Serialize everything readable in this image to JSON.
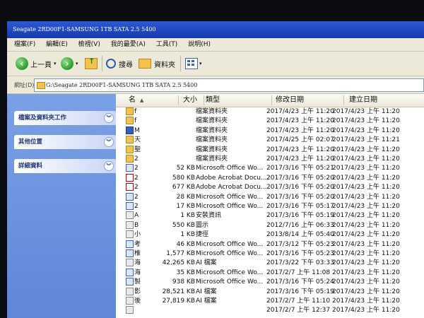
{
  "window": {
    "title": "Seagate 2RD00F1-SAMSUNG 1TB SATA 2.5 5400"
  },
  "menu": [
    "檔案(F)",
    "編輯(E)",
    "檢視(V)",
    "我的最愛(A)",
    "工具(T)",
    "說明(H)"
  ],
  "toolbar": {
    "back_label": "上一頁",
    "search_label": "搜尋",
    "folders_label": "資料夾"
  },
  "address": {
    "label": "網址(D)",
    "path": "G:\\Seagate 2RD00F1-SAMSUNG 1TB SATA 2.5 5400"
  },
  "task_panels": [
    "檔案及資料夾工作",
    "其他位置",
    "詳細資料"
  ],
  "columns": {
    "name": "名",
    "size": "大小",
    "type": "類型",
    "modified": "修改日期",
    "created": "建立日期"
  },
  "rows": [
    {
      "name": "f",
      "size": "",
      "type": "檔案資料夾",
      "modified": "2017/4/23 上午 11:20",
      "created": "2017/4/23 上午 11:20",
      "icon": "folder"
    },
    {
      "name": "f",
      "size": "",
      "type": "檔案資料夾",
      "modified": "2017/4/23 上午 11:20",
      "created": "2017/4/23 上午 11:20",
      "icon": "folder"
    },
    {
      "name": "M",
      "size": "",
      "type": "檔案資料夾",
      "modified": "2017/4/23 上午 11:20",
      "created": "2017/4/23 上午 11:20",
      "icon": "sel"
    },
    {
      "name": "天",
      "size": "",
      "type": "檔案資料夾",
      "modified": "2017/4/25 上午 02:07",
      "created": "2017/4/23 上午 11:21",
      "icon": "folder"
    },
    {
      "name": "聖",
      "size": "",
      "type": "檔案資料夾",
      "modified": "2017/4/23 上午 11:20",
      "created": "2017/4/23 上午 11:20",
      "icon": "folder"
    },
    {
      "name": "2",
      "size": "",
      "type": "檔案資料夾",
      "modified": "2017/4/23 上午 11:20",
      "created": "2017/4/23 上午 11:20",
      "icon": "folder"
    },
    {
      "name": "2",
      "size": "52 KB",
      "type": "Microsoft Office Wo...",
      "modified": "2017/3/16 下午 05:21",
      "created": "2017/4/23 上午 11:20",
      "icon": "doc"
    },
    {
      "name": "2",
      "size": "580 KB",
      "type": "Adobe Acrobat Docu...",
      "modified": "2017/3/16 下午 05:20",
      "created": "2017/4/23 上午 11:20",
      "icon": "pdf"
    },
    {
      "name": "2",
      "size": "677 KB",
      "type": "Adobe Acrobat Docu...",
      "modified": "2017/3/16 下午 05:20",
      "created": "2017/4/23 上午 11:20",
      "icon": "pdf"
    },
    {
      "name": "2",
      "size": "28 KB",
      "type": "Microsoft Office Wo...",
      "modified": "2017/3/16 下午 05:20",
      "created": "2017/4/23 上午 11:20",
      "icon": "doc"
    },
    {
      "name": "2",
      "size": "17 KB",
      "type": "Microsoft Office Wo...",
      "modified": "2017/3/16 下午 05:17",
      "created": "2017/4/23 上午 11:20",
      "icon": "doc"
    },
    {
      "name": "A",
      "size": "1 KB",
      "type": "安裝資訊",
      "modified": "2017/3/16 下午 05:19",
      "created": "2017/4/23 上午 11:20",
      "icon": "file"
    },
    {
      "name": "B",
      "size": "550 KB",
      "type": "圖示",
      "modified": "2012/7/16 上午 06:33",
      "created": "2017/4/23 上午 11:20",
      "icon": "file"
    },
    {
      "name": "小",
      "size": "1 KB",
      "type": "捷徑",
      "modified": "2013/8/14 上午 05:40",
      "created": "2017/4/23 上午 11:20",
      "icon": "file"
    },
    {
      "name": "考",
      "size": "46 KB",
      "type": "Microsoft Office Wo...",
      "modified": "2017/3/12 下午 05:23",
      "created": "2017/4/23 上午 11:20",
      "icon": "doc"
    },
    {
      "name": "椎",
      "size": "1,577 KB",
      "type": "Microsoft Office Wo...",
      "modified": "2017/3/16 下午 05:23",
      "created": "2017/4/23 上午 11:20",
      "icon": "doc"
    },
    {
      "name": "海",
      "size": "42,265 KB",
      "type": "AI 檔案",
      "modified": "2017/3/22 下午 03:33",
      "created": "2017/4/23 上午 11:20",
      "icon": "file"
    },
    {
      "name": "海",
      "size": "35 KB",
      "type": "Microsoft Office Wo...",
      "modified": "2017/2/7 上午 11:08",
      "created": "2017/4/23 上午 11:20",
      "icon": "doc"
    },
    {
      "name": "製",
      "size": "938 KB",
      "type": "Microsoft Office Wo...",
      "modified": "2017/3/16 下午 05:24",
      "created": "2017/4/23 上午 11:20",
      "icon": "doc"
    },
    {
      "name": "影",
      "size": "28,521 KB",
      "type": "AI 檔案",
      "modified": "2017/3/16 下午 05:19",
      "created": "2017/4/23 上午 11:20",
      "icon": "file"
    },
    {
      "name": "後",
      "size": "27,819 KB",
      "type": "AI 檔案",
      "modified": "2017/2/7 上午 11:10",
      "created": "2017/4/23 上午 11:20",
      "icon": "file"
    },
    {
      "name": "",
      "size": "",
      "type": "",
      "modified": "2017/2/7 上午 12:37",
      "created": "2017/4/23 上午 11:20",
      "icon": "file"
    }
  ],
  "colors": {
    "titlebar": "#1f46c0",
    "task_pane": "#6b92dd",
    "window_bg": "#ece9d8"
  }
}
